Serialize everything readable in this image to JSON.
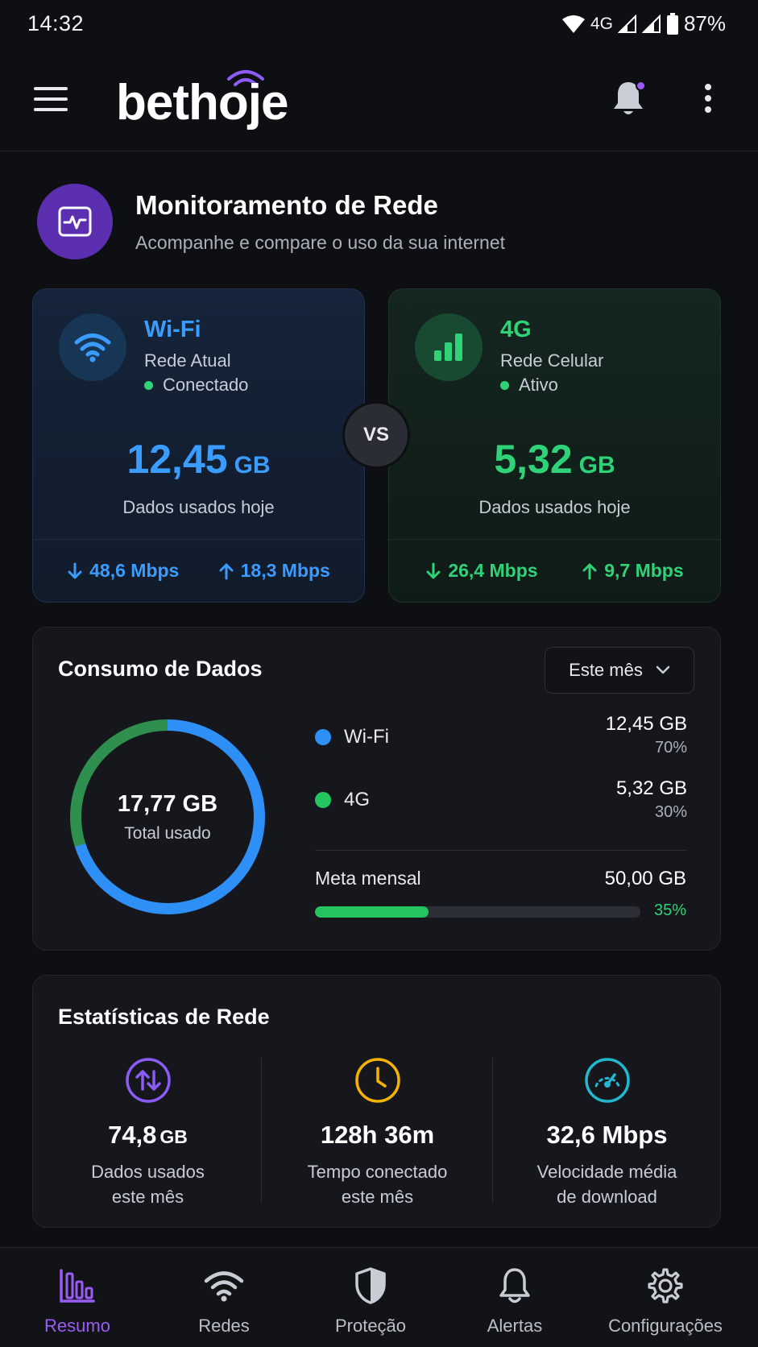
{
  "status_bar": {
    "time": "14:32",
    "network": "4G",
    "battery": "87%"
  },
  "app_bar": {
    "logo": "bethoje"
  },
  "header": {
    "title": "Monitoramento de Rede",
    "subtitle": "Acompanhe e compare o uso da sua internet"
  },
  "wifi_card": {
    "name": "Wi-Fi",
    "type": "Rede Atual",
    "state": "Conectado",
    "usage_value": "12,45",
    "usage_unit": "GB",
    "usage_label": "Dados usados hoje",
    "download": "48,6 Mbps",
    "upload": "18,3 Mbps"
  },
  "vs_label": "VS",
  "cell_card": {
    "name": "4G",
    "type": "Rede Celular",
    "state": "Ativo",
    "usage_value": "5,32",
    "usage_unit": "GB",
    "usage_label": "Dados usados hoje",
    "download": "26,4 Mbps",
    "upload": "9,7 Mbps"
  },
  "consumo": {
    "title": "Consumo de Dados",
    "period": "Este mês",
    "total": "17,77 GB",
    "total_label": "Total usado",
    "wifi_share": 70,
    "cell_share": 30,
    "legend": [
      {
        "name": "Wi-Fi",
        "value": "12,45 GB",
        "pct": "70%",
        "color": "#2e8ff7"
      },
      {
        "name": "4G",
        "value": "5,32 GB",
        "pct": "30%",
        "color": "#22c55e"
      }
    ],
    "meta_label": "Meta mensal",
    "meta_value": "50,00 GB",
    "meta_pct": "35%",
    "meta_fraction": 0.35
  },
  "stats": {
    "title": "Estatísticas de Rede",
    "items": [
      {
        "value": "74,8",
        "unit": "GB",
        "label_line1": "Dados usados",
        "label_line2": "este mês",
        "icon": "swap-vertical-icon",
        "color": "#8b5cf6"
      },
      {
        "value": "128h 36m",
        "unit": "",
        "label_line1": "Tempo conectado",
        "label_line2": "este mês",
        "icon": "clock-icon",
        "color": "#f5b301"
      },
      {
        "value": "32,6 Mbps",
        "unit": "",
        "label_line1": "Velocidade média",
        "label_line2": "de download",
        "icon": "speedometer-icon",
        "color": "#22b8cf"
      }
    ]
  },
  "bottom_nav": {
    "items": [
      {
        "label": "Resumo",
        "icon": "bar-chart-icon",
        "active": true
      },
      {
        "label": "Redes",
        "icon": "wifi-icon",
        "active": false
      },
      {
        "label": "Proteção",
        "icon": "shield-icon",
        "active": false
      },
      {
        "label": "Alertas",
        "icon": "bell-icon",
        "active": false
      },
      {
        "label": "Configurações",
        "icon": "gear-icon",
        "active": false
      }
    ],
    "active_color": "#9b5cf5"
  }
}
